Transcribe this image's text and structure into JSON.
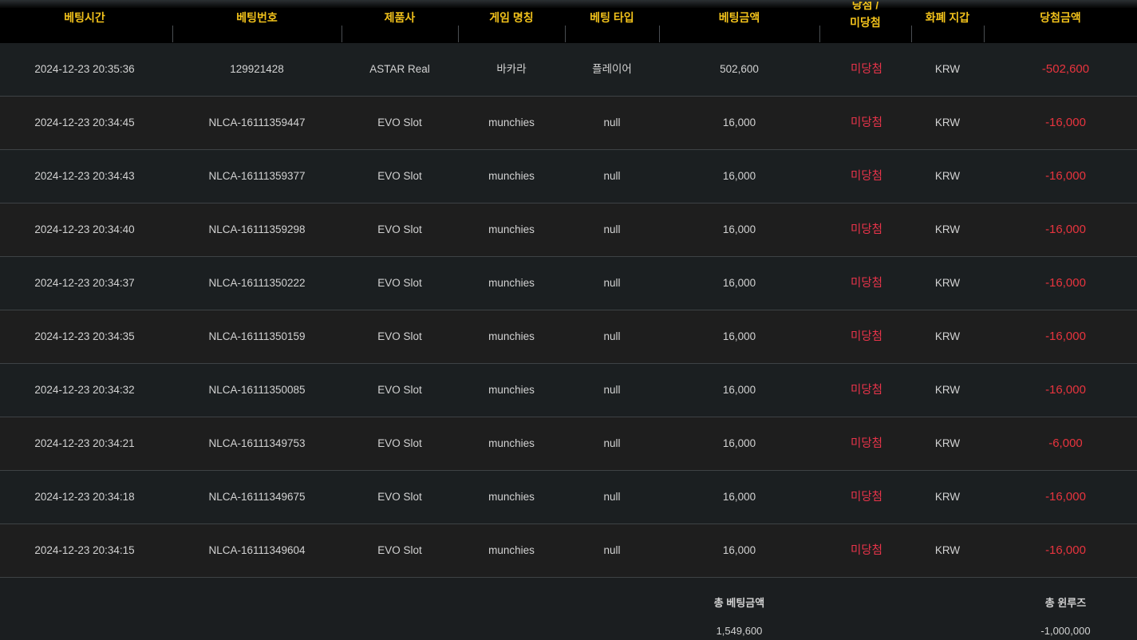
{
  "headers": {
    "bet_time": "베팅시간",
    "bet_no": "베팅번호",
    "provider": "제품사",
    "game_name": "게임 명칭",
    "bet_type": "베팅 타입",
    "bet_amount": "베팅금액",
    "result_line1": "당첨 /",
    "result_line2": "미당첨",
    "currency": "화폐 지갑",
    "win_amount": "당첨금액"
  },
  "rows": [
    {
      "time": "2024-12-23 20:35:36",
      "no": "129921428",
      "provider": "ASTAR Real",
      "game": "바카라",
      "type": "플레이어",
      "amount": "502,600",
      "result": "미당첨",
      "currency": "KRW",
      "win": "-502,600"
    },
    {
      "time": "2024-12-23 20:34:45",
      "no": "NLCA-16111359447",
      "provider": "EVO Slot",
      "game": "munchies",
      "type": "null",
      "amount": "16,000",
      "result": "미당첨",
      "currency": "KRW",
      "win": "-16,000"
    },
    {
      "time": "2024-12-23 20:34:43",
      "no": "NLCA-16111359377",
      "provider": "EVO Slot",
      "game": "munchies",
      "type": "null",
      "amount": "16,000",
      "result": "미당첨",
      "currency": "KRW",
      "win": "-16,000"
    },
    {
      "time": "2024-12-23 20:34:40",
      "no": "NLCA-16111359298",
      "provider": "EVO Slot",
      "game": "munchies",
      "type": "null",
      "amount": "16,000",
      "result": "미당첨",
      "currency": "KRW",
      "win": "-16,000"
    },
    {
      "time": "2024-12-23 20:34:37",
      "no": "NLCA-16111350222",
      "provider": "EVO Slot",
      "game": "munchies",
      "type": "null",
      "amount": "16,000",
      "result": "미당첨",
      "currency": "KRW",
      "win": "-16,000"
    },
    {
      "time": "2024-12-23 20:34:35",
      "no": "NLCA-16111350159",
      "provider": "EVO Slot",
      "game": "munchies",
      "type": "null",
      "amount": "16,000",
      "result": "미당첨",
      "currency": "KRW",
      "win": "-16,000"
    },
    {
      "time": "2024-12-23 20:34:32",
      "no": "NLCA-16111350085",
      "provider": "EVO Slot",
      "game": "munchies",
      "type": "null",
      "amount": "16,000",
      "result": "미당첨",
      "currency": "KRW",
      "win": "-16,000"
    },
    {
      "time": "2024-12-23 20:34:21",
      "no": "NLCA-16111349753",
      "provider": "EVO Slot",
      "game": "munchies",
      "type": "null",
      "amount": "16,000",
      "result": "미당첨",
      "currency": "KRW",
      "win": "-6,000"
    },
    {
      "time": "2024-12-23 20:34:18",
      "no": "NLCA-16111349675",
      "provider": "EVO Slot",
      "game": "munchies",
      "type": "null",
      "amount": "16,000",
      "result": "미당첨",
      "currency": "KRW",
      "win": "-16,000"
    },
    {
      "time": "2024-12-23 20:34:15",
      "no": "NLCA-16111349604",
      "provider": "EVO Slot",
      "game": "munchies",
      "type": "null",
      "amount": "16,000",
      "result": "미당첨",
      "currency": "KRW",
      "win": "-16,000"
    }
  ],
  "summary": {
    "total_bet_label": "총 베팅금액",
    "total_bet_value": "1,549,600",
    "total_winloss_label": "총 윈루즈",
    "total_winloss_value": "-1,000,000"
  },
  "colors": {
    "header_text": "#f2c21b",
    "lose_text": "#e8344a",
    "background": "#1b1e20"
  }
}
